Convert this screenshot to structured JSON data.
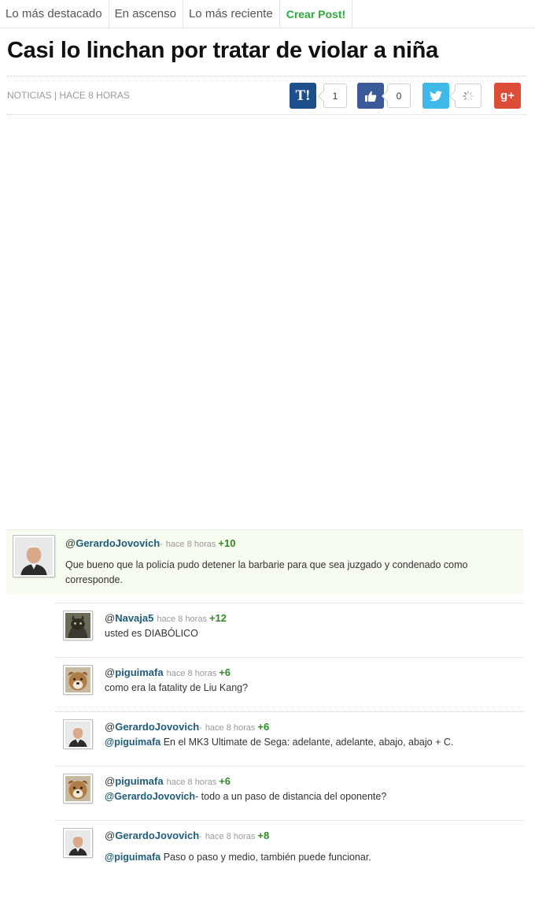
{
  "nav": {
    "tabs": [
      "Lo más destacado",
      "En ascenso",
      "Lo más reciente"
    ],
    "create_label": "Crear Post!"
  },
  "post": {
    "title": "Casi lo linchan por tratar de violar a niña",
    "category": "NOTICIAS",
    "separator": "|",
    "time": "HACE 8 HORAS"
  },
  "share": {
    "taringa_label": "T!",
    "taringa_count": "1",
    "facebook_count": "0",
    "googleplus_label": "g+",
    "icons": {
      "facebook": "thumbs-up-icon",
      "twitter": "twitter-bird-icon",
      "loading": "spinner-icon"
    },
    "colors": {
      "taringa": "#1d4f8c",
      "facebook": "#3b5a9a",
      "twitter": "#3fb9e7",
      "googleplus": "#dd4b39"
    }
  },
  "comments": {
    "main": {
      "at": "@",
      "user": "GerardoJovovich",
      "dash": "-",
      "time": "hace 8 horas",
      "score": "+10",
      "text": "Que bueno que la policía pudo detener la barbarie para que sea juzgado y condenado como corresponde."
    },
    "replies": [
      {
        "at": "@",
        "user": "Navaja5",
        "dash": "",
        "time": "hace 8 horas",
        "score": "+12",
        "mention": "",
        "mention_dash": "",
        "text": "usted es DIABÓLICO"
      },
      {
        "at": "@",
        "user": "piguimafa",
        "dash": "",
        "time": "hace 8 horas",
        "score": "+6",
        "mention": "",
        "mention_dash": "",
        "text": "como era la fatality de Liu Kang?"
      },
      {
        "at": "@",
        "user": "GerardoJovovich",
        "dash": "-",
        "time": "hace 8 horas",
        "score": "+6",
        "mention": "@piguimafa",
        "mention_dash": "",
        "text": " En el MK3 Ultimate de Sega: adelante, adelante, abajo, abajo + C."
      },
      {
        "at": "@",
        "user": "piguimafa",
        "dash": "",
        "time": "hace 8 horas",
        "score": "+6",
        "mention": "@GerardoJovovich",
        "mention_dash": "-",
        "text": " todo a un paso de distancia del oponente?"
      },
      {
        "at": "@",
        "user": "GerardoJovovich",
        "dash": "-",
        "time": "hace 8 horas",
        "score": "+8",
        "mention": "@piguimafa",
        "mention_dash": "",
        "text": " Paso o paso y medio, también puede funcionar."
      }
    ]
  }
}
